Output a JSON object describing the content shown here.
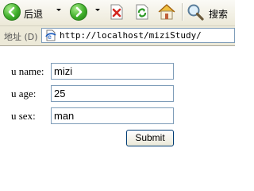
{
  "toolbar": {
    "back_label": "后退",
    "search_label": "搜索",
    "buttons": [
      "back-icon",
      "forward-icon",
      "stop-icon",
      "refresh-icon",
      "home-icon",
      "search-icon"
    ]
  },
  "address_bar": {
    "label": "地址 (D)",
    "url": "http://localhost/miziStudy/"
  },
  "form": {
    "name_label": "u name:",
    "name_value": "mizi",
    "age_label": "u age:",
    "age_value": "25",
    "sex_label": "u sex:",
    "sex_value": "man",
    "submit_label": "Submit"
  },
  "colors": {
    "toolbar_bg": "#ece9d8",
    "nav_green": "#3fae2a",
    "stop_red": "#d3261f",
    "input_border": "#7f9db9"
  }
}
